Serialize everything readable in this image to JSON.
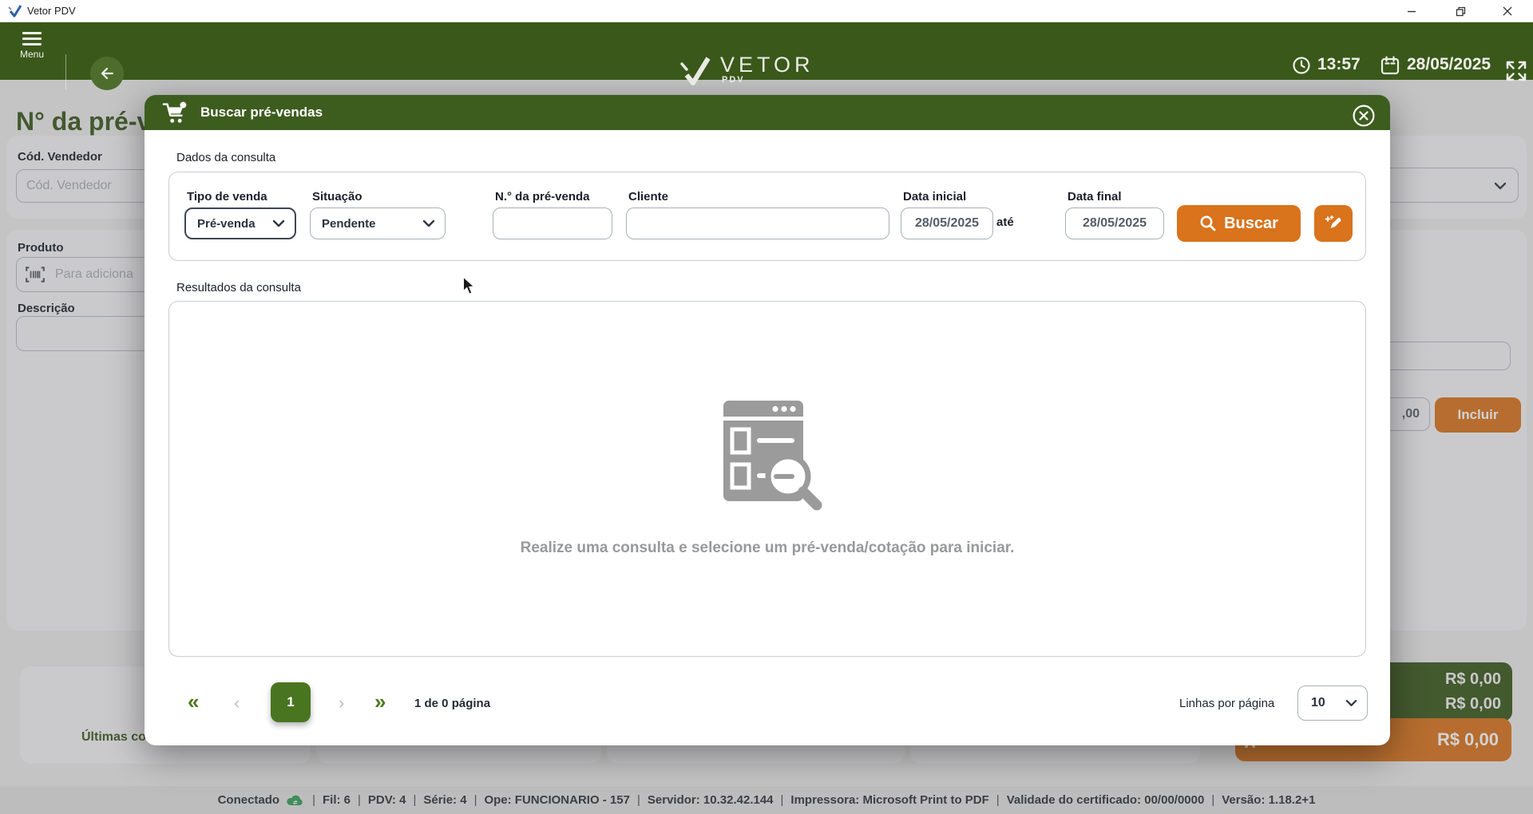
{
  "titlebar": {
    "app_title": "Vetor PDV"
  },
  "header": {
    "menu_label": "Menu",
    "logo_text": "VETOR",
    "logo_subtext": "PDV",
    "time": "13:57",
    "date": "28/05/2025"
  },
  "background": {
    "page_title": "N° da pré-ve",
    "cod_vendedor": {
      "label": "Cód. Vendedor",
      "placeholder": "Cód. Vendedor"
    },
    "produto": {
      "label": "Produto",
      "placeholder": "Para adiciona"
    },
    "descricao_label": "Descrição",
    "amount_value": ",00",
    "incluir_label": "Incluir",
    "ultimas_compras_label": "Últimas co",
    "total_1": "R$ 0,00",
    "total_2": "R$ 0,00",
    "total_destaque": "R$ 0,00"
  },
  "modal": {
    "title": "Buscar pré-vendas",
    "sections": {
      "consulta": "Dados da consulta",
      "resultados": "Resultados da consulta"
    },
    "fields": {
      "tipo_venda": {
        "label": "Tipo de venda",
        "value": "Pré-venda"
      },
      "situacao": {
        "label": "Situação",
        "value": "Pendente"
      },
      "numero": {
        "label": "N.° da pré-venda",
        "value": ""
      },
      "cliente": {
        "label": "Cliente",
        "value": ""
      },
      "data_inicial": {
        "label": "Data inicial",
        "value": "28/05/2025"
      },
      "ate_label": "até",
      "data_final": {
        "label": "Data final",
        "value": "28/05/2025"
      },
      "buscar_label": "Buscar"
    },
    "empty_message": "Realize uma consulta e selecione um pré-venda/cotação para iniciar.",
    "pagination": {
      "first_icon": "«",
      "prev_icon": "‹",
      "page": "1",
      "next_icon": "›",
      "last_icon": "»",
      "info": "1 de 0 página",
      "per_page_label": "Linhas por página",
      "per_page_value": "10"
    }
  },
  "statusbar": {
    "connected_label": "Conectado",
    "items": [
      "Fil: 6",
      "PDV: 4",
      "Série: 4",
      "Ope: FUNCIONARIO - 157",
      "Servidor: 10.32.42.144",
      "Impressora: Microsoft Print to PDF",
      "Validade do certificado: 00/00/0000",
      "Versão: 1.18.2+1"
    ]
  },
  "colors": {
    "primary_green": "#3A581A",
    "accent_orange": "#D9731C"
  }
}
